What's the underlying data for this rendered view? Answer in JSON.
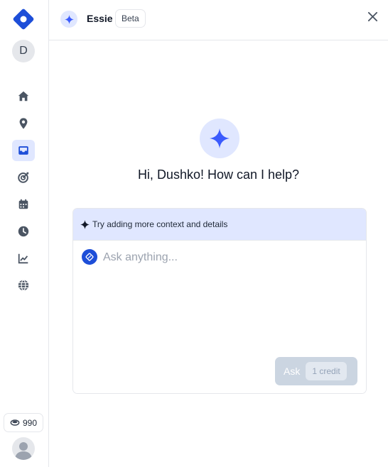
{
  "sidebar": {
    "user_initial": "D",
    "nav_items": [
      {
        "icon": "home-icon",
        "active": false
      },
      {
        "icon": "map-pin-icon",
        "active": false
      },
      {
        "icon": "inbox-icon",
        "active": true
      },
      {
        "icon": "target-icon",
        "active": false
      },
      {
        "icon": "calendar-icon",
        "active": false
      },
      {
        "icon": "clock-icon",
        "active": false
      },
      {
        "icon": "chart-line-icon",
        "active": false
      },
      {
        "icon": "globe-icon",
        "active": false
      }
    ],
    "credits": "990"
  },
  "header": {
    "title": "Essie",
    "badge": "Beta"
  },
  "main": {
    "greeting": "Hi, Dushko! How can I help?",
    "tip": "Try adding more context and details",
    "input_placeholder": "Ask anything...",
    "input_value": "",
    "ask_label": "Ask",
    "credit_label": "1 credit"
  },
  "colors": {
    "accent": "#1d4ed8",
    "accent_light": "#e0e7ff",
    "sparkle": "#3b5bfd",
    "icon_gray": "#4b5563",
    "button_disabled": "#cbd5e1"
  }
}
